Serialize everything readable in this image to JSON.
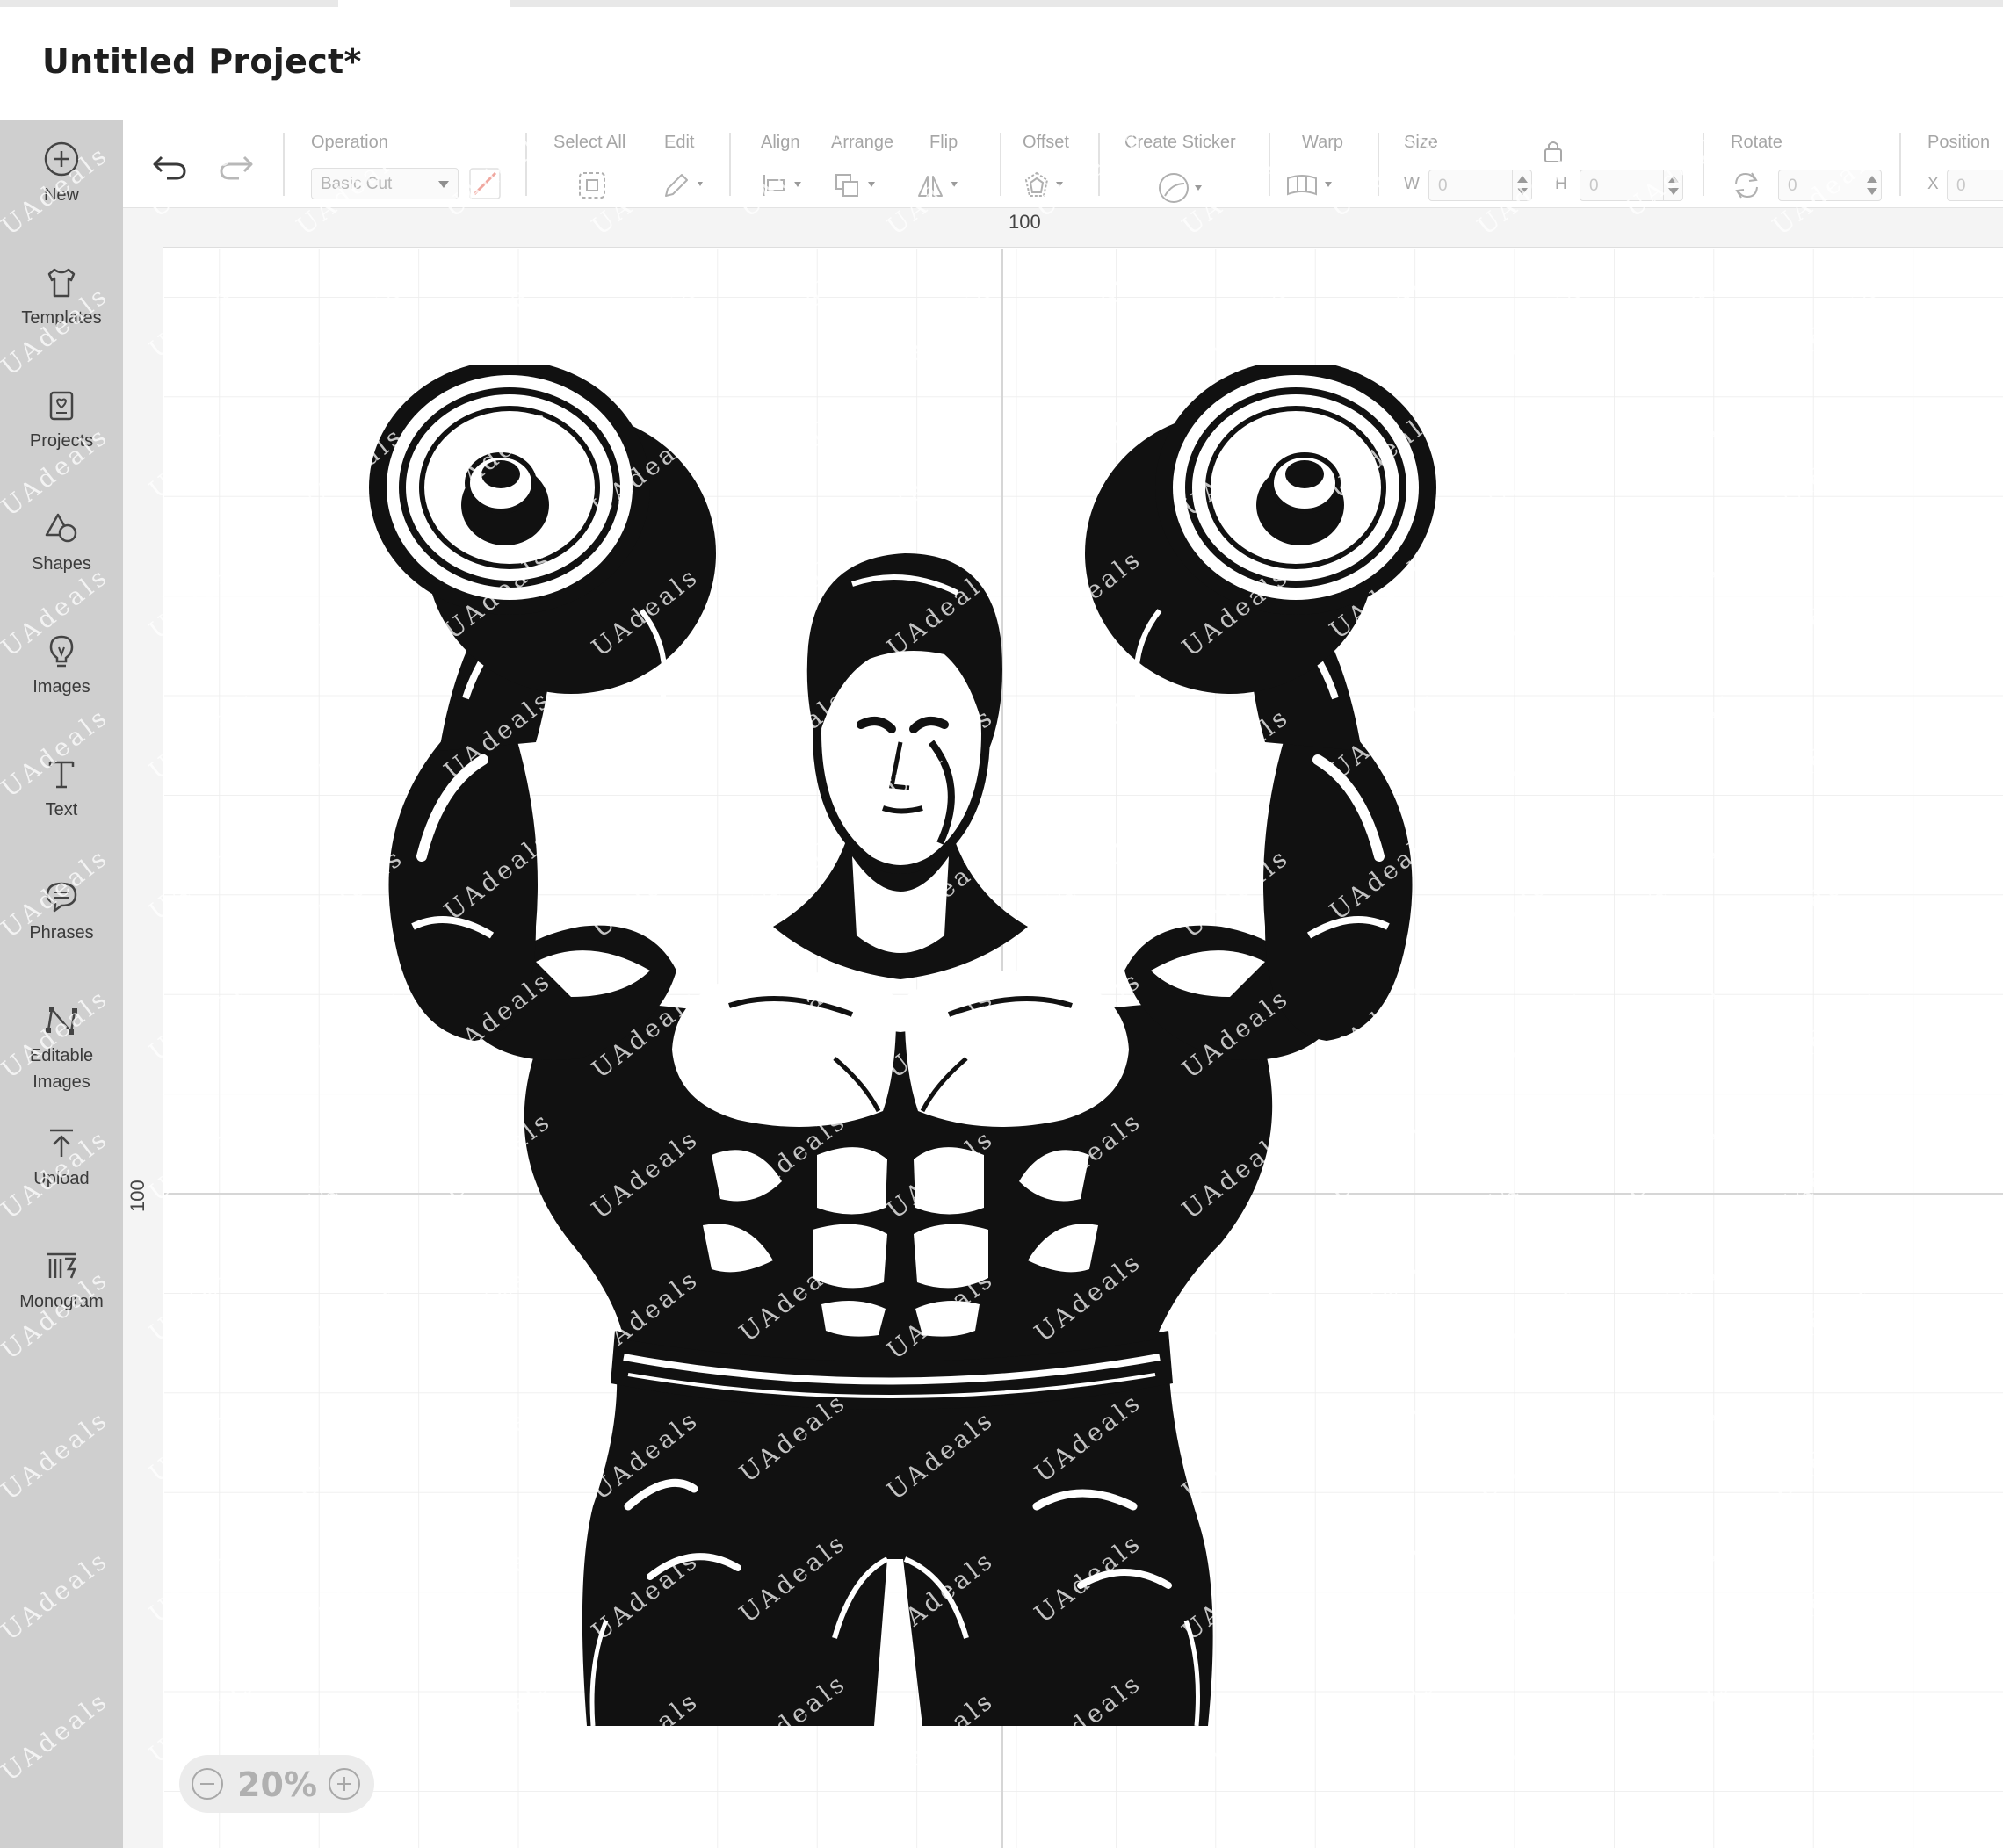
{
  "app": {
    "project_title": "Untitled Project*"
  },
  "sidebar": {
    "items": [
      {
        "label": "New",
        "icon": "plus-circle-icon"
      },
      {
        "label": "Templates",
        "icon": "tshirt-icon"
      },
      {
        "label": "Projects",
        "icon": "project-card-icon"
      },
      {
        "label": "Shapes",
        "icon": "shapes-icon"
      },
      {
        "label": "Images",
        "icon": "lightbulb-icon"
      },
      {
        "label": "Text",
        "icon": "text-t-icon"
      },
      {
        "label": "Phrases",
        "icon": "speech-bubble-icon"
      },
      {
        "label": "Editable Images",
        "icon": "node-edit-icon"
      },
      {
        "label": "Upload",
        "icon": "upload-icon"
      },
      {
        "label": "Monogram",
        "icon": "monogram-icon"
      }
    ]
  },
  "toolbar": {
    "undo_icon": "undo-icon",
    "redo_icon": "redo-icon",
    "operation_label": "Operation",
    "operation_value": "Basic Cut",
    "select_all_label": "Select All",
    "edit_label": "Edit",
    "align_label": "Align",
    "arrange_label": "Arrange",
    "flip_label": "Flip",
    "offset_label": "Offset",
    "create_sticker_label": "Create Sticker",
    "warp_label": "Warp",
    "size_label": "Size",
    "size_w_letter": "W",
    "size_w_value": "0",
    "size_h_letter": "H",
    "size_h_value": "0",
    "rotate_label": "Rotate",
    "rotate_value": "0",
    "position_label": "Position",
    "position_x_letter": "X",
    "position_x_value": "0"
  },
  "rulers": {
    "top_mark": "100",
    "left_mark": "100"
  },
  "zoom": {
    "value": "20%"
  },
  "watermark": {
    "text": "UAdeals"
  },
  "colors": {
    "sidebar_bg": "#cfcfcf",
    "grid_line": "#e6e6e6",
    "linetype_swatch": "#f0a8a0",
    "art_ink": "#111111"
  }
}
